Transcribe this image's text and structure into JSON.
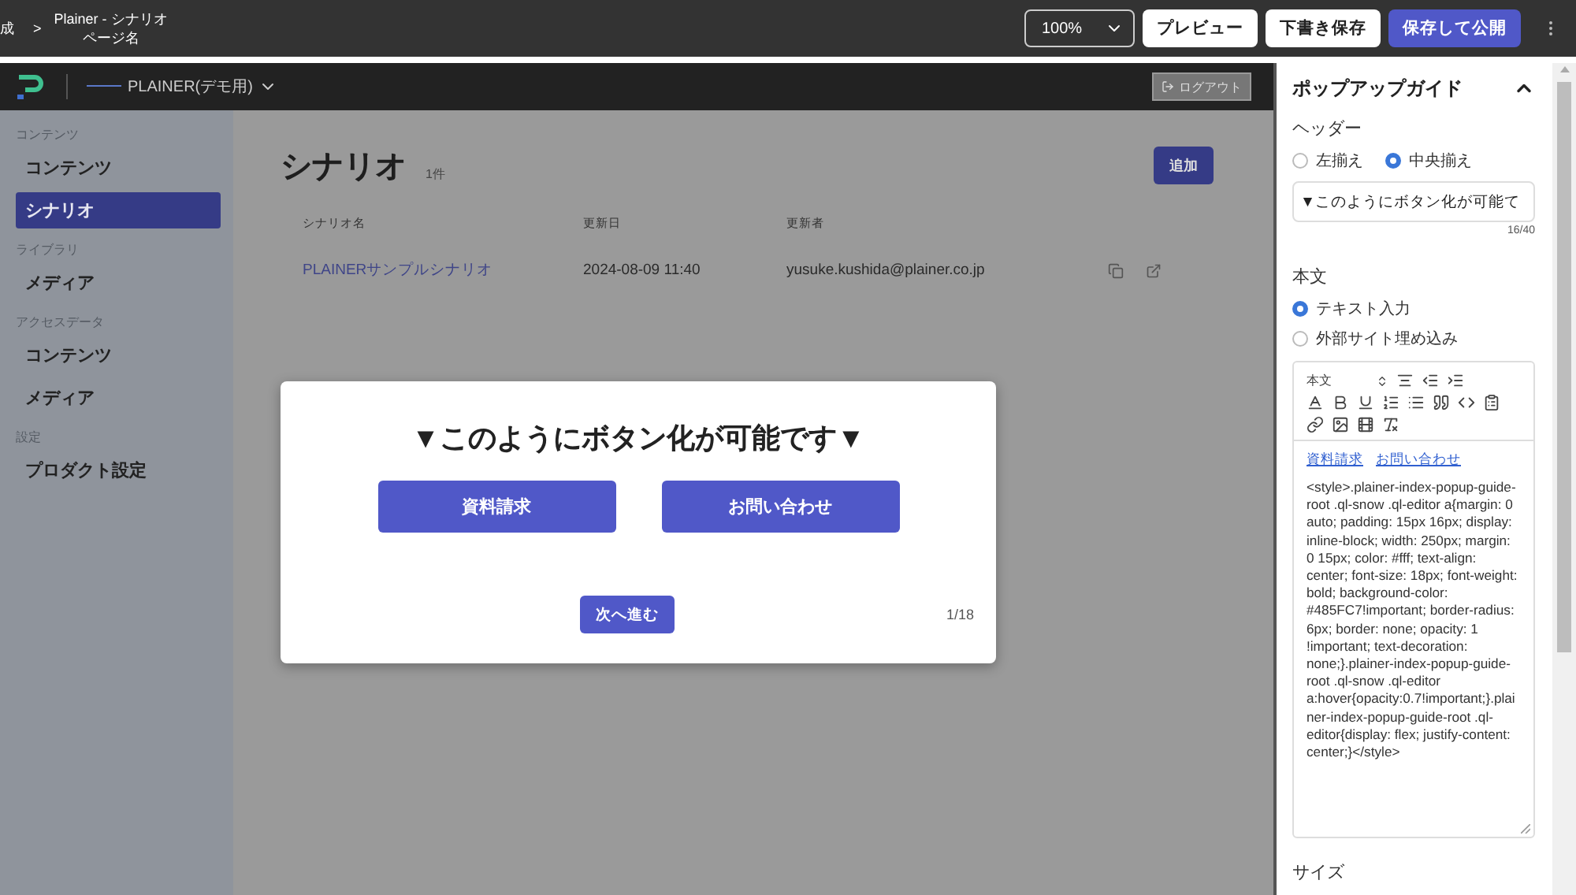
{
  "top_bar": {
    "crumb_cut": "成",
    "separator": ">",
    "title": "Plainer - シナリオ",
    "subtitle": "ページ名",
    "zoom": "100%",
    "buttons": [
      {
        "label": "プレビュー",
        "kind": "secondary"
      },
      {
        "label": "下書き保存",
        "kind": "secondary"
      },
      {
        "label": "保存して公開",
        "kind": "primary"
      }
    ]
  },
  "app": {
    "brand": "PLAINER(デモ用)",
    "logout": "ログアウト",
    "sidebar": [
      {
        "heading": "コンテンツ",
        "items": [
          {
            "label": "コンテンツ",
            "selected": false
          },
          {
            "label": "シナリオ",
            "selected": true
          }
        ]
      },
      {
        "heading": "ライブラリ",
        "items": [
          {
            "label": "メディア",
            "selected": false
          }
        ]
      },
      {
        "heading": "アクセスデータ",
        "items": [
          {
            "label": "コンテンツ",
            "selected": false
          },
          {
            "label": "メディア",
            "selected": false
          }
        ]
      },
      {
        "heading": "設定",
        "items": [
          {
            "label": "プロダクト設定",
            "selected": false
          }
        ]
      }
    ],
    "page": {
      "title": "シナリオ",
      "count": "1件",
      "add": "追加",
      "columns": [
        "シナリオ名",
        "更新日",
        "更新者"
      ],
      "rows": [
        {
          "name": "PLAINERサンプルシナリオ",
          "updated": "2024-08-09 11:40",
          "author": "yusuke.kushida@plainer.co.jp"
        }
      ]
    }
  },
  "popup": {
    "title": "▼このようにボタン化が可能です▼",
    "buttons": [
      "資料請求",
      "お問い合わせ"
    ],
    "next": "次へ進む",
    "page": "1/18"
  },
  "panel": {
    "title": "ポップアップガイド",
    "expanded": true,
    "header": {
      "label": "ヘッダー",
      "align": [
        {
          "label": "左揃え",
          "selected": false
        },
        {
          "label": "中央揃え",
          "selected": true
        }
      ],
      "value": "▼このようにボタン化が可能て",
      "counter": "16/40"
    },
    "body": {
      "label": "本文",
      "modes": [
        {
          "label": "テキスト入力",
          "selected": true
        },
        {
          "label": "外部サイト埋め込み",
          "selected": false
        }
      ],
      "format": "本文",
      "links": [
        "資料請求",
        "お問い合わせ"
      ],
      "code": "<style>.plainer-index-popup-guide-root .ql-snow .ql-editor a{margin: 0 auto; padding: 15px 16px; display: inline-block; width: 250px; margin: 0 15px; color: #fff; text-align: center; font-size: 18px; font-weight: bold; background-color: #485FC7!important; border-radius: 6px; border: none; opacity: 1 !important; text-decoration: none;}.plainer-index-popup-guide-root .ql-snow .ql-editor a:hover{opacity:0.7!important;}.plainer-index-popup-guide-root .ql-editor{display: flex; justify-content: center;}</style>"
    },
    "size": {
      "label": "サイズ"
    }
  }
}
